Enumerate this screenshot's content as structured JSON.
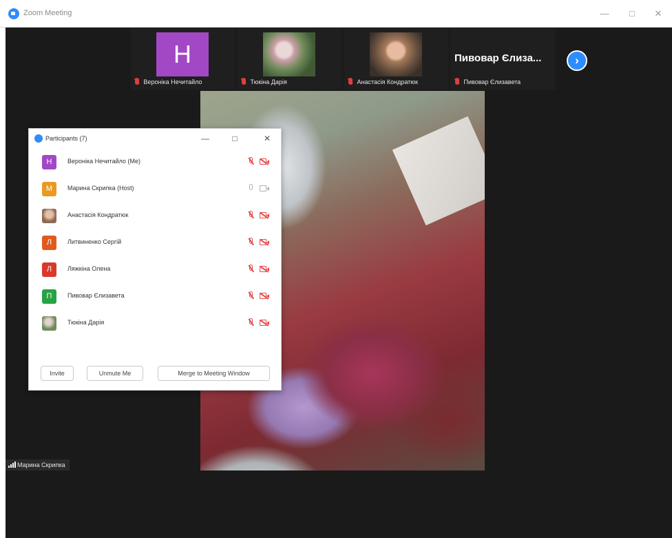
{
  "window": {
    "title": "Zoom Meeting",
    "minimize_icon": "minimize-icon",
    "maximize_icon": "maximize-icon",
    "close_icon": "close-icon"
  },
  "gallery": {
    "thumbs": [
      {
        "name": "Вероніка Нечитайло",
        "tile": "H",
        "muted": true
      },
      {
        "name": "Тюкіна Дарія",
        "tile": "photo",
        "muted": true
      },
      {
        "name": "Анастасія Кондратюк",
        "tile": "photo",
        "muted": true
      },
      {
        "name": "Пивовар Єлизавета",
        "tile": "name",
        "muted": true
      }
    ],
    "big_name": "Пивовар Єлиза...",
    "next_icon": "chevron-right-icon"
  },
  "participants": {
    "title": "Participants (7)",
    "rows": [
      {
        "name": "Вероніка Нечитайло (Me)",
        "initial": "Н",
        "color": "#a248c5",
        "mic": "muted",
        "cam": "off"
      },
      {
        "name": "Марина Скрипка (Host)",
        "initial": "М",
        "color": "#e89a23",
        "mic": "on",
        "cam": "on"
      },
      {
        "name": "Анастасія Кондратюк",
        "initial": "",
        "color": "#8c6a55",
        "mic": "muted",
        "cam": "off"
      },
      {
        "name": "Литвиненко Сергій",
        "initial": "Л",
        "color": "#e05a1e",
        "mic": "muted",
        "cam": "off"
      },
      {
        "name": "Ляжкіна Олена",
        "initial": "Л",
        "color": "#d93a2b",
        "mic": "muted",
        "cam": "off"
      },
      {
        "name": "Пивовар Єлизавета",
        "initial": "П",
        "color": "#29a244",
        "mic": "muted",
        "cam": "off"
      },
      {
        "name": "Тюкіна Дарія",
        "initial": "",
        "color": "#6f8b5a",
        "mic": "muted",
        "cam": "off"
      }
    ],
    "buttons": {
      "invite": "Invite",
      "unmute": "Unmute Me",
      "merge": "Merge to Meeting Window"
    }
  },
  "self_label": "Марина Скрипка",
  "colors": {
    "accent": "#2d8cff",
    "muted_red": "#e54848"
  }
}
